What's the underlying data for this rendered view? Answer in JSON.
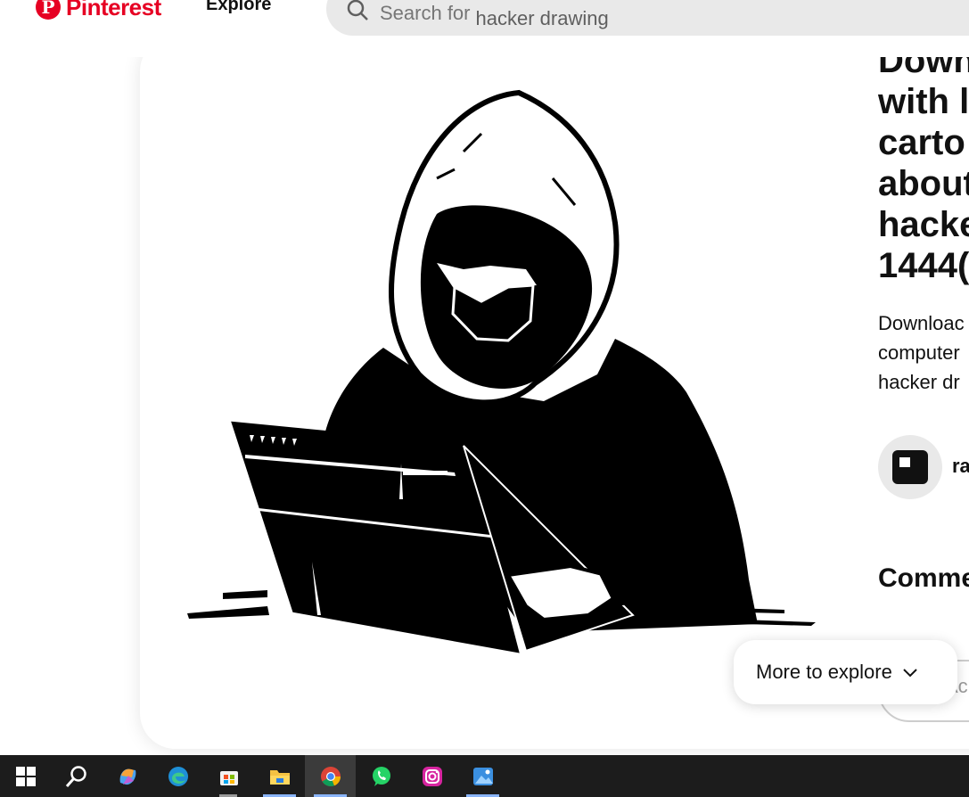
{
  "header": {
    "logo_text": "Pinterest",
    "logo_mark": "P",
    "nav_explore": "Explore",
    "search_placeholder": "Search for",
    "search_value": "hacker drawing"
  },
  "pin": {
    "title_lines": [
      "Down",
      "with l",
      "carto",
      "about",
      "hacke",
      "1444("
    ],
    "description_lines": [
      "Downloac",
      "computer",
      "hacker dr"
    ],
    "creator_name": "ra",
    "comments_heading": "Comme",
    "comment_placeholder": "Ac",
    "more_to_explore": "More to explore",
    "image_icon": "hooded-hacker-laptop-illustration"
  },
  "taskbar": {
    "items": [
      {
        "icon": "windows-start-icon"
      },
      {
        "icon": "search-icon"
      },
      {
        "icon": "copilot-icon"
      },
      {
        "icon": "edge-icon"
      },
      {
        "icon": "microsoft-store-icon"
      },
      {
        "icon": "file-explorer-icon"
      },
      {
        "icon": "chrome-icon"
      },
      {
        "icon": "whatsapp-icon"
      },
      {
        "icon": "instagram-icon"
      },
      {
        "icon": "photos-icon"
      }
    ]
  },
  "colors": {
    "brand": "#e60023",
    "taskbar": "#1c1c1c",
    "search_bg": "#e9e9e9"
  }
}
